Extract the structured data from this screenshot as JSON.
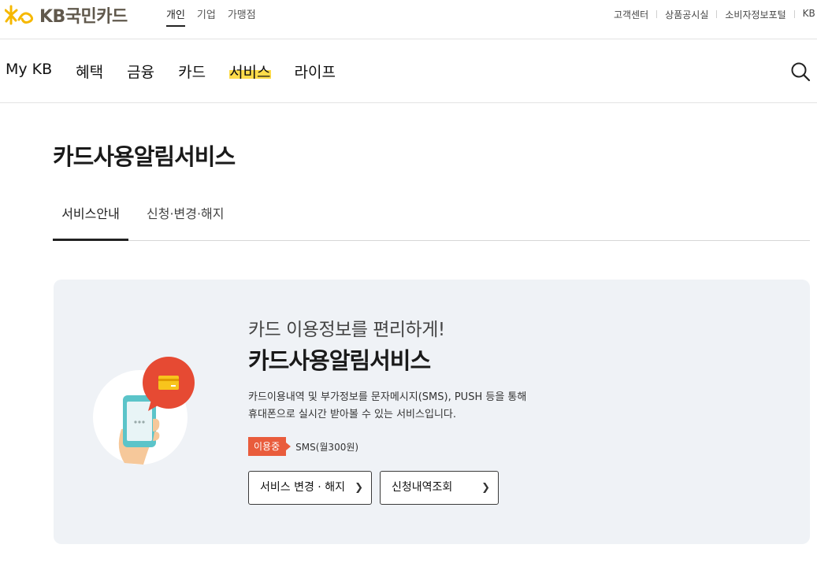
{
  "header": {
    "logo_text": "KB국민카드",
    "segment_tabs": [
      "개인",
      "기업",
      "가맹점"
    ],
    "util_links": [
      "고객센터",
      "상품공시실",
      "소비자정보포털",
      "KB"
    ]
  },
  "gnb": {
    "items": [
      "My KB",
      "혜택",
      "금융",
      "카드",
      "서비스",
      "라이프"
    ],
    "active": "서비스",
    "search_icon": "search-icon"
  },
  "page": {
    "title": "카드사용알림서비스",
    "tabs": [
      "서비스안내",
      "신청·변경·해지"
    ]
  },
  "service_card": {
    "subtitle": "카드 이용정보를 편리하게!",
    "title": "카드사용알림서비스",
    "desc_line1": "카드이용내역 및 부가정보를 문자메시지(SMS), PUSH 등을 통해",
    "desc_line2": "휴대폰으로 실시간 받아볼 수 있는 서비스입니다.",
    "status_badge": "이용중",
    "status_plan": "SMS(월300원)",
    "buttons": [
      "서비스 변경 · 해지",
      "신청내역조회"
    ]
  },
  "colors": {
    "accent_yellow": "#ffdc4a",
    "badge_red": "#e95c3c",
    "card_bg": "#eff2f6"
  }
}
